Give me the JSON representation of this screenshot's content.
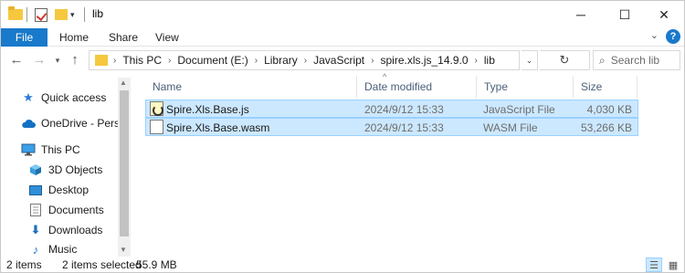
{
  "window": {
    "title": "lib",
    "controls": {
      "minimize": "─",
      "maximize": "☐",
      "close": "✕"
    }
  },
  "ribbon": {
    "tabs": [
      "File",
      "Home",
      "Share",
      "View"
    ],
    "help": "?"
  },
  "address": {
    "path": [
      "This PC",
      "Document (E:)",
      "Library",
      "JavaScript",
      "spire.xls.js_14.9.0",
      "lib"
    ],
    "search_placeholder": "Search lib"
  },
  "nav": {
    "items": [
      {
        "label": "Quick access",
        "icon": "star-icon"
      },
      {
        "label": "OneDrive - Person",
        "icon": "cloud-icon"
      },
      {
        "label": "This PC",
        "icon": "computer-icon"
      },
      {
        "label": "3D Objects",
        "icon": "cube-icon"
      },
      {
        "label": "Desktop",
        "icon": "desktop-icon"
      },
      {
        "label": "Documents",
        "icon": "documents-icon"
      },
      {
        "label": "Downloads",
        "icon": "download-icon"
      },
      {
        "label": "Music",
        "icon": "music-icon"
      }
    ]
  },
  "columns": [
    "Name",
    "Date modified",
    "Type",
    "Size"
  ],
  "files": [
    {
      "name": "Spire.Xls.Base.js",
      "date": "2024/9/12 15:33",
      "type": "JavaScript File",
      "size": "4,030 KB",
      "selected": true
    },
    {
      "name": "Spire.Xls.Base.wasm",
      "date": "2024/9/12 15:33",
      "type": "WASM File",
      "size": "53,266 KB",
      "selected": true
    }
  ],
  "status": {
    "items": "2 items",
    "selected": "2 items selected",
    "size": "55.9 MB"
  },
  "colors": {
    "accent": "#1979ca",
    "selection_bg": "#cce8ff",
    "selection_border": "#99d1ff"
  }
}
